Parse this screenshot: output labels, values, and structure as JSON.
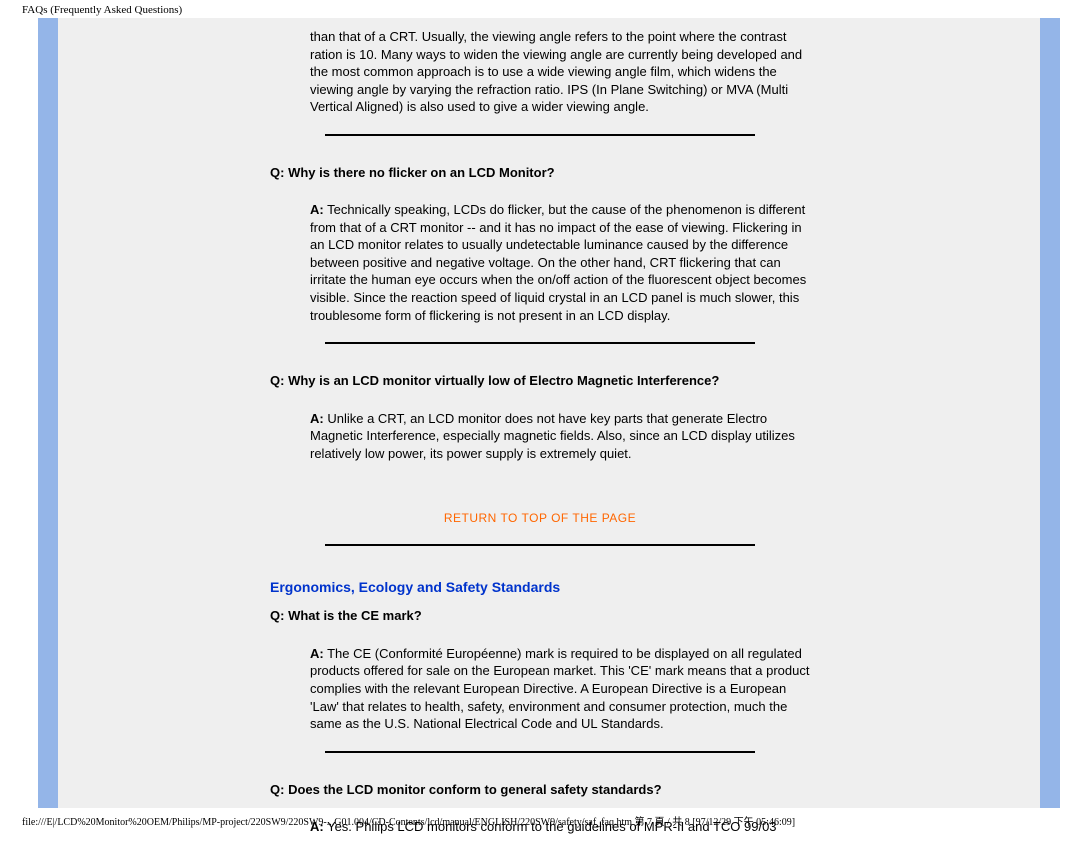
{
  "header": {
    "title": "FAQs (Frequently Asked Questions)"
  },
  "content": {
    "intro_answer": "than that of a CRT. Usually, the viewing angle refers to the point where the contrast ration is 10. Many ways to widen the viewing angle are currently being developed and the most common approach is to use a wide viewing angle film, which widens the viewing angle by varying the refraction ratio. IPS (In Plane Switching) or MVA (Multi Vertical Aligned) is also used to give a wider viewing angle.",
    "q1_label": "Q:",
    "q1_text": " Why is there no flicker on an LCD Monitor?",
    "a1_label": "A:",
    "a1_text": " Technically speaking, LCDs do flicker, but the cause of the phenomenon is different from that of a CRT monitor -- and it has no impact of the ease of viewing. Flickering in an LCD monitor relates to usually undetectable luminance caused by the difference between positive and negative voltage. On the other hand, CRT flickering that can irritate the human eye occurs when the on/off action of the fluorescent object becomes visible. Since the reaction speed of liquid crystal in an LCD panel is much slower, this troublesome form of flickering is not present in an LCD display.",
    "q2_label": "Q:",
    "q2_text": " Why is an LCD monitor virtually low of Electro Magnetic Interference?",
    "a2_label": "A:",
    "a2_text": " Unlike a CRT, an LCD monitor does not have key parts that generate Electro Magnetic Interference, especially magnetic fields. Also, since an LCD display utilizes relatively low power, its power supply is extremely quiet.",
    "return_link": "RETURN TO TOP OF THE PAGE",
    "section_heading": "Ergonomics, Ecology and Safety Standards",
    "q3_label": "Q:",
    "q3_text": " What is the CE mark?",
    "a3_label": "A:",
    "a3_text": " The CE (Conformité Européenne) mark is required to be displayed on all regulated products offered for sale on the European market. This 'CE' mark means that a product complies with the relevant European Directive. A European Directive is a European 'Law' that relates to health, safety, environment and consumer protection, much the same as the U.S. National Electrical Code and UL Standards.",
    "q4_label": "Q:",
    "q4_text": " Does the LCD monitor conform to general safety standards?",
    "a4_label": "A:",
    "a4_text": " Yes. Philips LCD monitors conform to the guidelines of MPR-II and TCO 99/03"
  },
  "footer": {
    "path": "file:///E|/LCD%20Monitor%20OEM/Philips/MP-project/220SW9/220SW9-...G01.004/CD-Contents/lcd/manual/ENGLISH/220SW9/safety/saf_faq.htm 第 7 頁 / 共 8  [97/12/29 下午 05:46:09]"
  }
}
